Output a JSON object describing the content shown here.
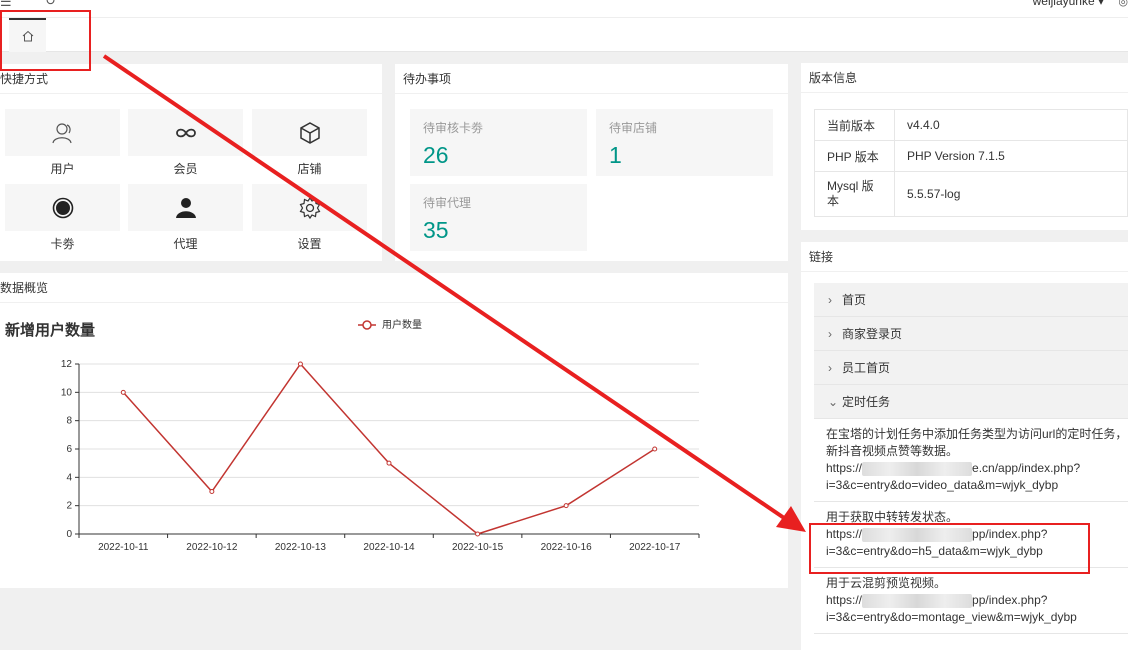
{
  "topbar": {
    "user": "weijiayunke ▾",
    "menu_icon": "☰",
    "refresh_icon": "↻",
    "extra_icon": "◎"
  },
  "tabs": {
    "home_icon": "home-icon"
  },
  "quick": {
    "title": "快捷方式",
    "items": [
      {
        "label": "用户",
        "icon": "user-icon"
      },
      {
        "label": "会员",
        "icon": "infinity-icon"
      },
      {
        "label": "店铺",
        "icon": "cube-icon"
      },
      {
        "label": "卡劵",
        "icon": "target-icon"
      },
      {
        "label": "代理",
        "icon": "person-icon"
      },
      {
        "label": "设置",
        "icon": "gear-icon"
      }
    ]
  },
  "todo": {
    "title": "待办事项",
    "items": [
      {
        "label": "待审核卡劵",
        "value": "26"
      },
      {
        "label": "待审店铺",
        "value": "1"
      },
      {
        "label": "待审代理",
        "value": "35"
      }
    ]
  },
  "overview": {
    "title": "数据概览"
  },
  "chart_data": {
    "type": "line",
    "title": "新增用户数量",
    "legend_position": "top",
    "categories": [
      "2022-10-11",
      "2022-10-12",
      "2022-10-13",
      "2022-10-14",
      "2022-10-15",
      "2022-10-16",
      "2022-10-17"
    ],
    "series": [
      {
        "name": "用户数量",
        "values": [
          10,
          3,
          12,
          5,
          0,
          2,
          6
        ],
        "color": "#c23531"
      }
    ],
    "y_ticks": [
      "0",
      "2",
      "4",
      "6",
      "8",
      "10",
      "12"
    ],
    "ylim": [
      0,
      12
    ],
    "grid": true
  },
  "version": {
    "title": "版本信息",
    "rows": [
      {
        "key": "当前版本",
        "value": "v4.4.0"
      },
      {
        "key": "PHP 版本",
        "value": "PHP Version 7.1.5"
      },
      {
        "key_line1": "Mysql 版",
        "key_line2": "本",
        "value": "5.5.57-log"
      }
    ]
  },
  "links": {
    "title": "链接",
    "items": [
      "首页",
      "商家登录页",
      "员工首页",
      "定时任务"
    ],
    "chevron_closed": "›",
    "chevron_open": "⌄",
    "tasks": [
      {
        "l1": "在宝塔的计划任务中添加任务类型为访问url的定时任务，",
        "l2": "新抖音视频点赞等数据。",
        "l3a": "https://",
        "l3b": "e.cn/app/index.php?",
        "l4": "i=3&c=entry&do=video_data&m=wjyk_dybp"
      },
      {
        "l1": "用于获取中转转发状态。",
        "l3a": "https://",
        "l3b": "pp/index.php?",
        "l4": "i=3&c=entry&do=h5_data&m=wjyk_dybp"
      },
      {
        "l1": "用于云混剪预览视频。",
        "l3a": "https://",
        "l3b": "pp/index.php?",
        "l4": "i=3&c=entry&do=montage_view&m=wjyk_dybp"
      }
    ]
  },
  "colors": {
    "accent": "#009688",
    "annotation": "#e82020",
    "series": "#c23531"
  }
}
